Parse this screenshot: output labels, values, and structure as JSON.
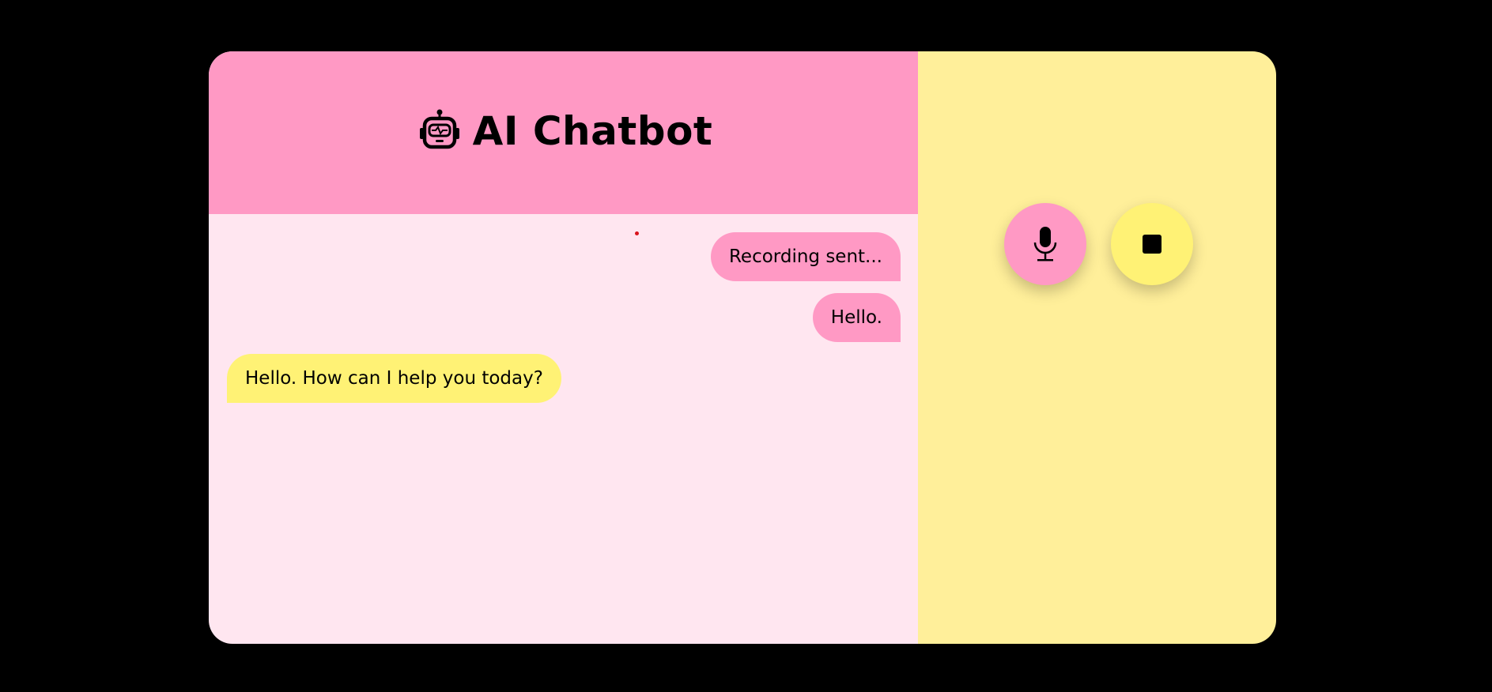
{
  "header": {
    "title": "AI Chatbot",
    "icon": "robot-icon"
  },
  "messages": [
    {
      "role": "user",
      "text": "Recording sent..."
    },
    {
      "role": "user",
      "text": "Hello."
    },
    {
      "role": "bot",
      "text": "Hello. How can I help you today?"
    }
  ],
  "controls": {
    "record_icon": "microphone-icon",
    "stop_icon": "stop-icon"
  },
  "colors": {
    "header_bg": "#ff99c4",
    "chat_bg": "#ffe6f0",
    "panel_bg": "#ffef9a",
    "user_bubble": "#ff99c4",
    "bot_bubble": "#fff275",
    "recording_indicator": "#d9131c"
  }
}
